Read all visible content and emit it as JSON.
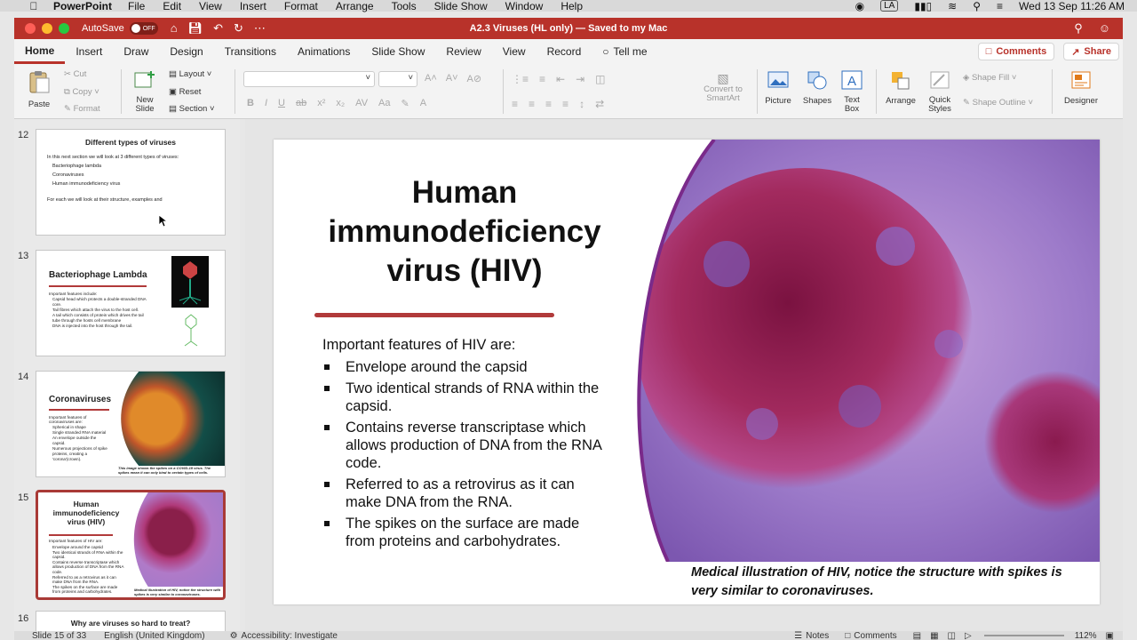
{
  "menubar": {
    "app": "PowerPoint",
    "items": [
      "File",
      "Edit",
      "View",
      "Insert",
      "Format",
      "Arrange",
      "Tools",
      "Slide Show",
      "Window",
      "Help"
    ],
    "user": "LA",
    "clock": "Wed 13 Sep  11:26 AM"
  },
  "titlebar": {
    "autosave": "AutoSave",
    "toggle": "OFF",
    "title": "A2.3 Viruses (HL only) — Saved to my Mac"
  },
  "tabs": [
    "Home",
    "Insert",
    "Draw",
    "Design",
    "Transitions",
    "Animations",
    "Slide Show",
    "Review",
    "View",
    "Record"
  ],
  "tell_me": "Tell me",
  "comments_label": "Comments",
  "share_label": "Share",
  "ribbon": {
    "paste": "Paste",
    "cut": "Cut",
    "copy": "Copy",
    "format": "Format",
    "new_slide_1": "New",
    "new_slide_2": "Slide",
    "layout": "Layout",
    "reset": "Reset",
    "section": "Section",
    "convert_1": "Convert to",
    "convert_2": "SmartArt",
    "picture": "Picture",
    "shapes": "Shapes",
    "textbox_1": "Text",
    "textbox_2": "Box",
    "arrange": "Arrange",
    "quick_1": "Quick",
    "quick_2": "Styles",
    "shape_fill": "Shape Fill",
    "shape_outline": "Shape Outline",
    "designer": "Designer"
  },
  "thumbs": {
    "t12": {
      "num": "12",
      "title": "Different types of viruses",
      "intro": "In this next section we will look at 3 different types of viruses:",
      "bullets": [
        "Bacteriophage lambda",
        "Coronaviruses",
        "Human immunodeficiency virus"
      ],
      "outro": "For each we will look at their structure, examples and"
    },
    "t13": {
      "num": "13",
      "title": "Bacteriophage Lambda",
      "intro": "Important features include:",
      "bullets": [
        "Capsid head which protects a double-stranded DNA core.",
        "Tail fibres which attach the virus to the host cell.",
        "A tail which consists of protein which drives the tail tube through the hosts cell membrane",
        "DNA is injected into the host through the tail."
      ]
    },
    "t14": {
      "num": "14",
      "title": "Coronaviruses",
      "intro": "Important features of coronaviruses are:",
      "bullets": [
        "Spherical in shape",
        "Single stranded RNA material",
        "An envelope outside the capsid.",
        "Numerous projections of spike proteins, creating a 'corona'(crown)."
      ],
      "caption": "This image shows the spikes on a COVID-19 virus. The spikes mean it can only bind to certain types of cells."
    },
    "t15": {
      "num": "15",
      "title": "Human immunodeficiency virus (HIV)",
      "intro": "Important features of HIV are:",
      "bullets": [
        "Envelope around the capsid",
        "Two identical strands of RNA within the capsid.",
        "Contains reverse transcriptase which allows production of DNA from the RNA code.",
        "Referred to as a retrovirus as it can make DNA from the RNA.",
        "The spikes on the surface are made from proteins and carbohydrates."
      ],
      "caption": "Medical illustration of HIV, notice the structure with spikes is very similar to coronaviruses."
    },
    "t16": {
      "num": "16",
      "title": "Why are viruses so hard to treat?"
    }
  },
  "slide": {
    "title_1": "Human",
    "title_2": "immunodeficiency",
    "title_3": "virus (HIV)",
    "intro": "Important features of HIV are:",
    "bullets": [
      "Envelope around the capsid",
      "Two identical strands of RNA within the capsid.",
      "Contains reverse transcriptase which allows production of DNA from the RNA code.",
      "Referred to as a retrovirus as it can make DNA from the RNA.",
      "The spikes on the surface are made from proteins and carbohydrates."
    ],
    "caption": "Medical illustration of HIV, notice the structure with spikes is very similar to coronaviruses."
  },
  "status": {
    "slide": "Slide 15 of 33",
    "language": "English (United Kingdom)",
    "accessibility": "Accessibility: Investigate",
    "notes": "Notes",
    "comments": "Comments",
    "zoom": "112%"
  },
  "colors": {
    "accent": "#b8322a",
    "title_line": "#b13a3a",
    "selected_border": "#a93a36"
  }
}
